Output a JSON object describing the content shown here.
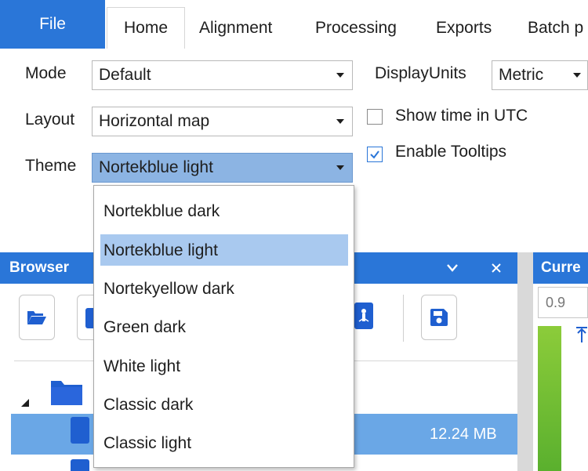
{
  "ribbon": {
    "tabs": [
      {
        "label": "File"
      },
      {
        "label": "Home"
      },
      {
        "label": "Alignment"
      },
      {
        "label": "Processing"
      },
      {
        "label": "Exports"
      },
      {
        "label": "Batch p"
      }
    ]
  },
  "settings": {
    "mode_label": "Mode",
    "mode_value": "Default",
    "display_units_label": "DisplayUnits",
    "display_units_value": "Metric",
    "layout_label": "Layout",
    "layout_value": "Horizontal map",
    "theme_label": "Theme",
    "theme_value": "Nortekblue light",
    "show_time_utc_label": "Show time in UTC",
    "show_time_utc_checked": false,
    "enable_tooltips_label": "Enable Tooltips",
    "enable_tooltips_checked": true
  },
  "theme_dropdown": {
    "options": [
      "Nortekblue dark",
      "Nortekblue light",
      "Nortekyellow dark",
      "Green dark",
      "White light",
      "Classic dark",
      "Classic light"
    ],
    "highlighted": "Nortekblue light"
  },
  "browser": {
    "title": "Browser",
    "selected_file_size": "12.24 MB"
  },
  "current_panel": {
    "title": "Curre",
    "input_value": "0.9"
  },
  "colors": {
    "accent": "#2a76d8",
    "selection": "#6aa7e6",
    "dropdown_highlight": "#a9c9ef",
    "active_combo": "#8cb4e3"
  }
}
